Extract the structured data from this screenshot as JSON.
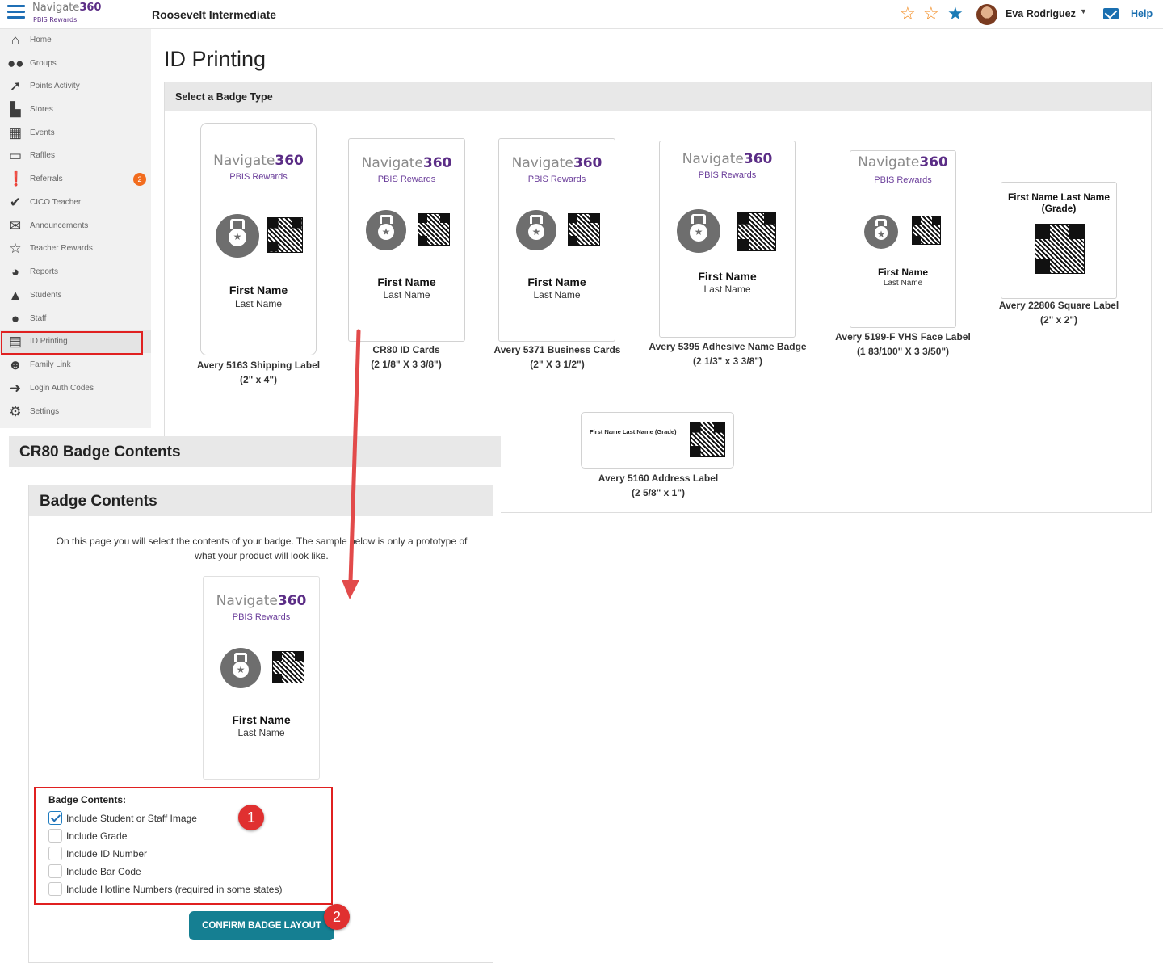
{
  "header": {
    "logo_word": "Navigate",
    "logo_num": "360",
    "logo_sub": "PBIS Rewards",
    "school": "Roosevelt Intermediate",
    "user": "Eva Rodriguez",
    "help": "Help",
    "colors": {
      "star_orange": "#f28a1e",
      "star_blue": "#1b7bb6",
      "accent": "#1a6fb0",
      "brand": "#5b2d86"
    }
  },
  "sidebar": {
    "items": [
      {
        "label": "Home",
        "icon": "home-icon"
      },
      {
        "label": "Groups",
        "icon": "groups-icon"
      },
      {
        "label": "Points Activity",
        "icon": "rocket-icon"
      },
      {
        "label": "Stores",
        "icon": "cart-icon"
      },
      {
        "label": "Events",
        "icon": "calendar-icon"
      },
      {
        "label": "Raffles",
        "icon": "ticket-icon"
      },
      {
        "label": "Referrals",
        "icon": "alert-icon",
        "badge": "2"
      },
      {
        "label": "CICO Teacher",
        "icon": "check-circle-icon"
      },
      {
        "label": "Announcements",
        "icon": "envelope-icon"
      },
      {
        "label": "Teacher Rewards",
        "icon": "star-icon"
      },
      {
        "label": "Reports",
        "icon": "pie-chart-icon"
      },
      {
        "label": "Students",
        "icon": "graduation-cap-icon"
      },
      {
        "label": "Staff",
        "icon": "user-icon"
      },
      {
        "label": "ID Printing",
        "icon": "printer-icon"
      },
      {
        "label": "Family Link",
        "icon": "family-icon"
      },
      {
        "label": "Login Auth Codes",
        "icon": "sign-in-icon"
      },
      {
        "label": "Settings",
        "icon": "gear-icon"
      }
    ]
  },
  "page": {
    "title": "ID Printing",
    "panel_header": "Select a Badge Type"
  },
  "badges": {
    "first_name": "First Name",
    "last_name": "Last Name",
    "b1": {
      "line1": "Avery 5163 Shipping Label",
      "line2": "(2\" x 4\")"
    },
    "b2": {
      "line1": "CR80 ID Cards",
      "line2": "(2 1/8\" X 3 3/8\")"
    },
    "b3": {
      "line1": "Avery 5371 Business Cards",
      "line2": "(2\" X 3 1/2\")"
    },
    "b4": {
      "line1": "Avery 5395 Adhesive Name Badge",
      "line2": "(2 1/3\" x 3 3/8\")"
    },
    "b5": {
      "line1": "Avery 5199-F VHS Face Label",
      "line2": "(1 83/100\" X 3 3/50\")"
    },
    "b6": {
      "line1": "Avery 22806 Square Label",
      "line2": "(2\" x 2\")",
      "card_title": "First Name  Last Name",
      "card_sub": "(Grade)"
    },
    "b7": {
      "line1": "Avery 5160 Address Label",
      "line2": "(2 5/8\" x 1\")",
      "card_text": "First Name  Last Name (Grade)"
    }
  },
  "overlay": {
    "title": "CR80 Badge Contents",
    "inner_title": "Badge Contents",
    "description": "On this page you will select the contents of your badge. The sample below is only a prototype of what your product will look like.",
    "contents_label": "Badge Contents:",
    "options": [
      {
        "label": "Include Student or Staff Image",
        "checked": true
      },
      {
        "label": "Include Grade",
        "checked": false
      },
      {
        "label": "Include ID Number",
        "checked": false
      },
      {
        "label": "Include Bar Code",
        "checked": false
      },
      {
        "label": "Include Hotline Numbers (required in some states)",
        "checked": false
      }
    ],
    "confirm_button": "CONFIRM BADGE LAYOUT",
    "callout_1": "1",
    "callout_2": "2"
  }
}
